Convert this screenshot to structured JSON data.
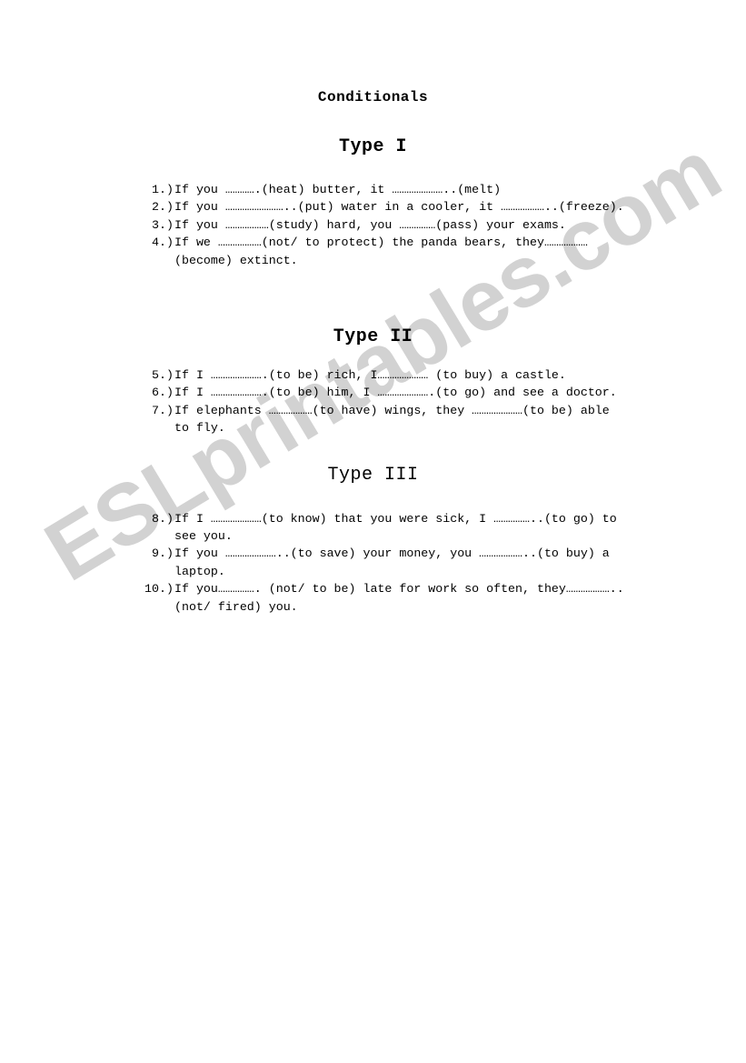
{
  "document": {
    "title": "Conditionals",
    "watermark": "ESLprintables.com",
    "watermark_color": "#d2d2d2",
    "text_color": "#000000",
    "background_color": "#ffffff"
  },
  "sections": [
    {
      "heading": "Type I",
      "heading_style": "bold",
      "items": [
        {
          "number": "1.)",
          "text": "If you ………….(heat) butter, it …………………..(melt)"
        },
        {
          "number": "2.)",
          "text": "If you ……………………..(put) water in a cooler, it ………………..(freeze)."
        },
        {
          "number": "3.)",
          "text": "If you ………………(study) hard, you ……………(pass) your exams."
        },
        {
          "number": "4.)",
          "text": "If we ………………(not/ to protect) the panda bears, they……………… (become) extinct."
        }
      ]
    },
    {
      "heading": "Type II",
      "heading_style": "bold",
      "items": [
        {
          "number": "5.)",
          "text": "If I ………………….(to be) rich, I………………… (to buy) a castle."
        },
        {
          "number": "6.)",
          "text": "If I ………………….(to be) him, I ………………….(to go) and see a doctor."
        },
        {
          "number": "7.)",
          "text": "If elephants ………………(to have) wings, they …………………(to be) able to fly."
        }
      ]
    },
    {
      "heading": "Type III",
      "heading_style": "regular",
      "items": [
        {
          "number": "8.)",
          "text": "If I …………………(to know) that you were sick, I ……………..(to go) to see you."
        },
        {
          "number": "9.)",
          "text": "If you …………………..(to save) your money, you ………………..(to buy) a laptop."
        },
        {
          "number": "10.)",
          "text": "If you……………. (not/ to be) late for work so often, they……………….. (not/ fired) you."
        }
      ]
    }
  ]
}
